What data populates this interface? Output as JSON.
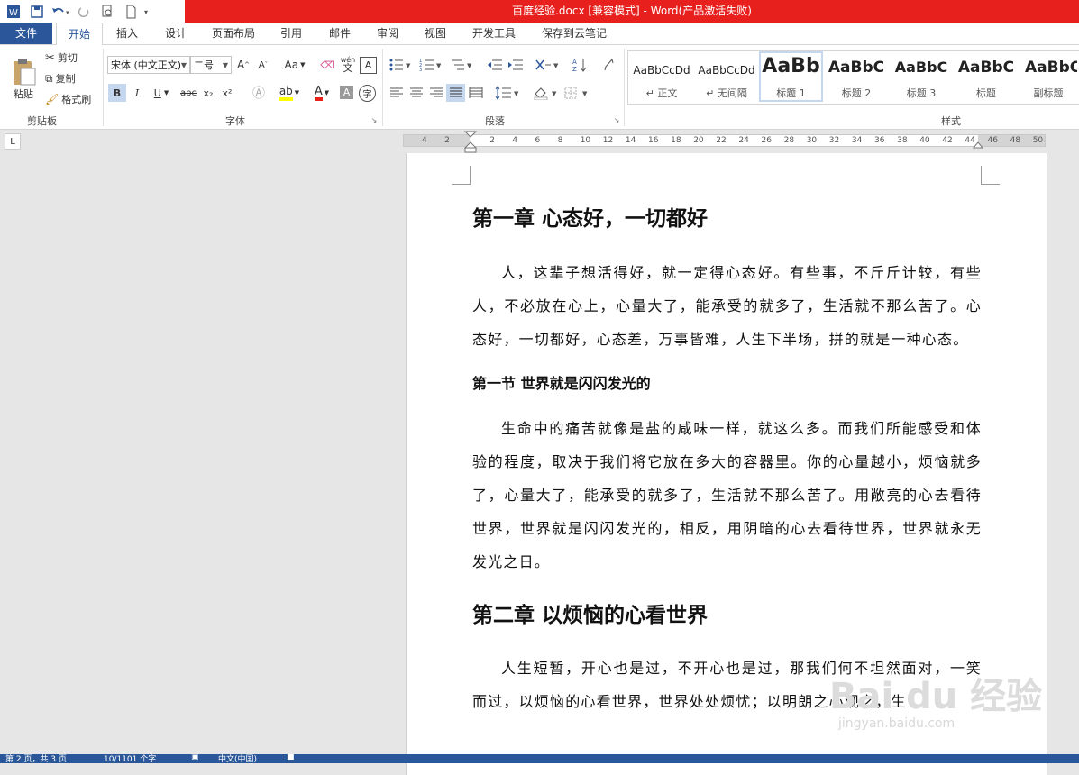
{
  "window": {
    "title": "百度经验.docx [兼容模式] -  Word(产品激活失败)"
  },
  "tabs": [
    "文件",
    "开始",
    "插入",
    "设计",
    "页面布局",
    "引用",
    "邮件",
    "审阅",
    "视图",
    "开发工具",
    "保存到云笔记"
  ],
  "clipboard": {
    "paste": "粘贴",
    "cut": "剪切",
    "copy": "复制",
    "format_painter": "格式刷",
    "group": "剪贴板"
  },
  "font": {
    "name": "宋体 (中文正文)",
    "size": "二号",
    "group": "字体",
    "case": "Aa",
    "wen": "wén",
    "bold": "B",
    "italic": "I",
    "underline": "U",
    "strike": "abc",
    "sub": "x₂",
    "sup": "x²"
  },
  "paragraph": {
    "group": "段落"
  },
  "styles": {
    "group": "样式",
    "items": [
      {
        "preview": "AaBbCcDd",
        "name": "↵ 正文"
      },
      {
        "preview": "AaBbCcDd",
        "name": "↵ 无间隔"
      },
      {
        "preview": "AaBb",
        "name": "标题 1"
      },
      {
        "preview": "AaBbC",
        "name": "标题 2"
      },
      {
        "preview": "AaBbC",
        "name": "标题 3"
      },
      {
        "preview": "AaBbC",
        "name": "标题"
      },
      {
        "preview": "AaBbC",
        "name": "副标题"
      }
    ]
  },
  "ruler": [
    "4",
    "2",
    "",
    "2",
    "4",
    "6",
    "8",
    "10",
    "12",
    "14",
    "16",
    "18",
    "20",
    "22",
    "24",
    "26",
    "28",
    "30",
    "32",
    "34",
    "36",
    "38",
    "40",
    "42",
    "44",
    "46",
    "48",
    "50"
  ],
  "document": {
    "h1a": "第一章  心态好，一切都好",
    "p1": "人，这辈子想活得好，就一定得心态好。有些事，不斤斤计较，有些人，不必放在心上，心量大了，能承受的就多了，生活就不那么苦了。心态好，一切都好，心态差，万事皆难，人生下半场，拼的就是一种心态。",
    "h2a": "第一节  世界就是闪闪发光的",
    "p2": "生命中的痛苦就像是盐的咸味一样，就这么多。而我们所能感受和体验的程度，取决于我们将它放在多大的容器里。你的心量越小，烦恼就多了，心量大了，能承受的就多了，生活就不那么苦了。用敞亮的心去看待世界，世界就是闪闪发光的，相反，用阴暗的心去看待世界，世界就永无发光之日。",
    "h1b": "第二章  以烦恼的心看世界",
    "p3": "人生短暂，开心也是过，不开心也是过，那我们何不坦然面对，一笑而过，以烦恼的心看世界，世界处处烦忧；以明朗之心观之，生"
  },
  "watermark": {
    "brand": "Bai du 经验",
    "site": "jingyan.baidu.com"
  },
  "status": {
    "page": "第 2 页，共 3 页",
    "words": "10/1101 个字",
    "lang": "中文(中国)"
  }
}
